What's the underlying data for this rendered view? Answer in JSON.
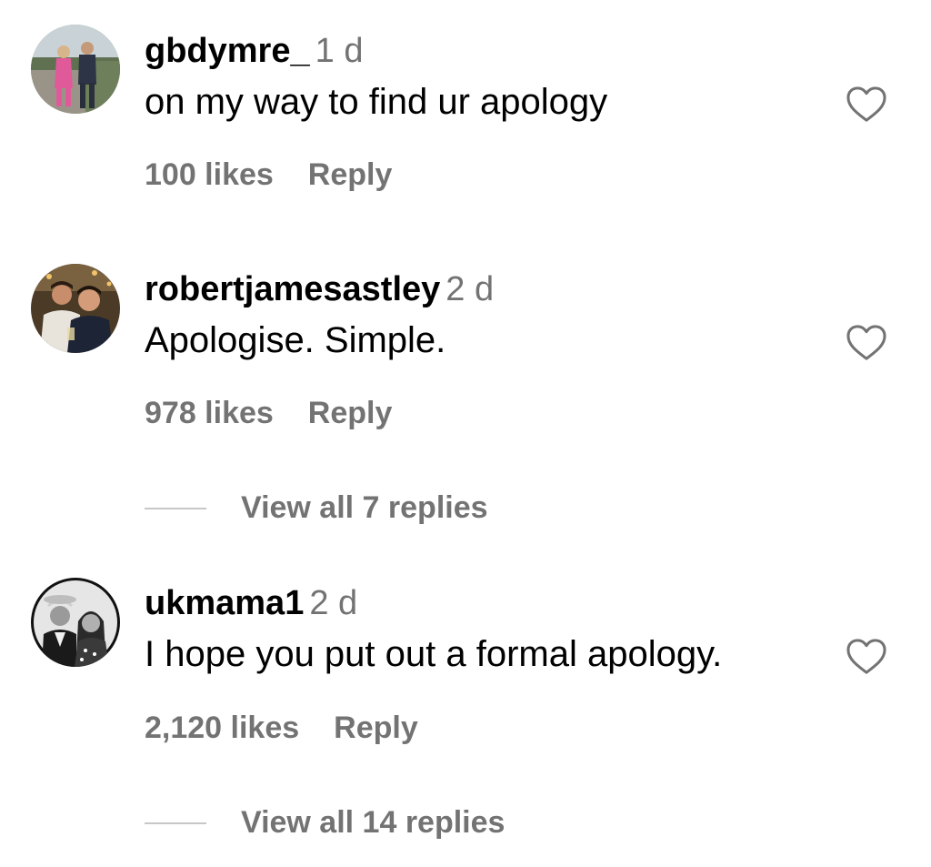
{
  "comments": [
    {
      "username": "gbdymre_",
      "time": "1 d",
      "text": "on my way to find ur apology",
      "likes": "100 likes",
      "reply_label": "Reply",
      "avatar_icon": "profile-photo-couple-walking"
    },
    {
      "username": "robertjamesastley",
      "time": "2 d",
      "text": "Apologise. Simple.",
      "likes": "978 likes",
      "reply_label": "Reply",
      "view_replies": "View all 7 replies",
      "avatar_icon": "profile-photo-two-men"
    },
    {
      "username": "ukmama1",
      "time": "2 d",
      "text": "I hope you put out a formal apology.",
      "likes": "2,120 likes",
      "reply_label": "Reply",
      "view_replies": "View all 14 replies",
      "avatar_icon": "profile-photo-couple-bw"
    }
  ],
  "colors": {
    "primary_text": "#000000",
    "secondary_text": "#737373",
    "divider": "#c7c7c7"
  }
}
